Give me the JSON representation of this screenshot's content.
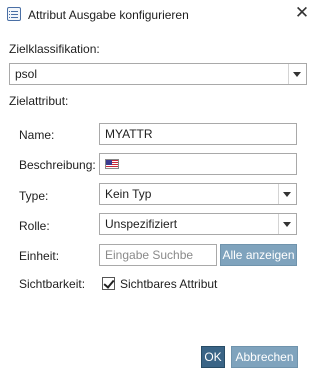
{
  "window": {
    "title": "Attribut Ausgabe konfigurieren",
    "close_symbol": "✕"
  },
  "target_class": {
    "label": "Zielklassifikation:",
    "value": "psol"
  },
  "target_attribute": {
    "section_label": "Zielattribut:"
  },
  "form": {
    "name": {
      "label": "Name:",
      "value": "MYATTR"
    },
    "description": {
      "label": "Beschreibung:",
      "value": "",
      "locale_flag": "us-flag-icon"
    },
    "type": {
      "label": "Type:",
      "value": "Kein Typ"
    },
    "role": {
      "label": "Rolle:",
      "value": "Unspezifiziert"
    },
    "unit": {
      "label": "Einheit:",
      "placeholder": "Eingabe Suchbe",
      "show_all_label": "Alle anzeigen"
    },
    "visibility": {
      "label": "Sichtbarkeit:",
      "checkbox_label": "Sichtbares Attribut",
      "checked": true
    }
  },
  "actions": {
    "ok_label": "OK",
    "cancel_label": "Abbrechen"
  },
  "colors": {
    "primary_button": "#3a6486",
    "secondary_button": "#7fa3bd"
  }
}
